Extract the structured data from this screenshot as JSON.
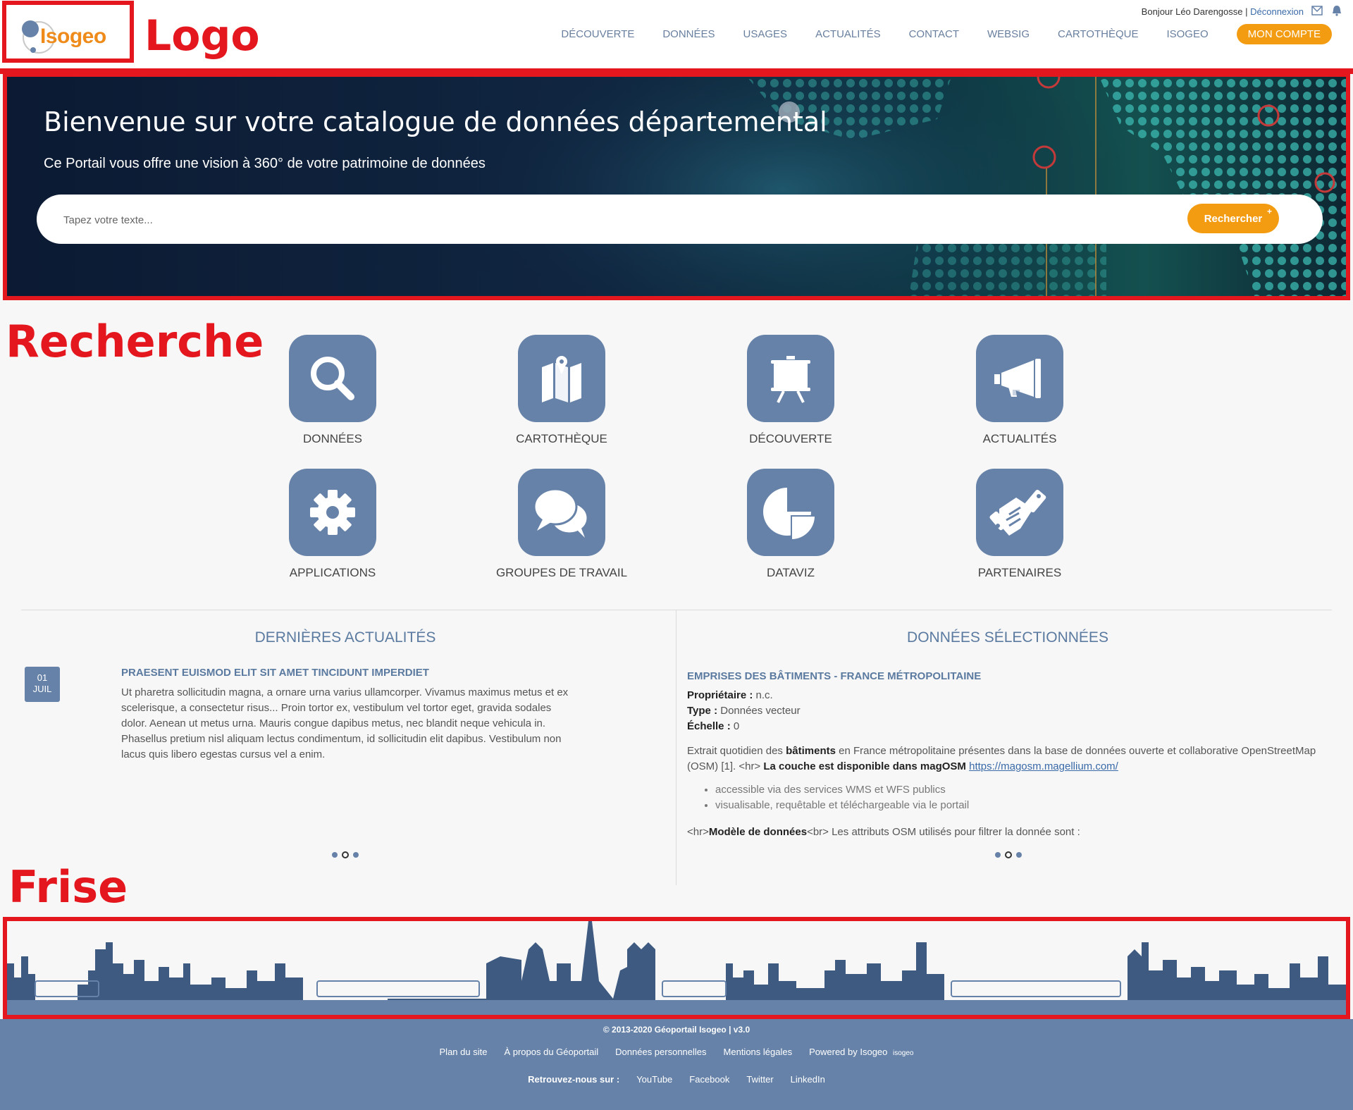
{
  "annotations": {
    "logo": "Logo",
    "search": "Recherche",
    "frieze": "Frise"
  },
  "logo": {
    "text": "Isogeo"
  },
  "header": {
    "greeting": "Bonjour Léo Darengosse |",
    "logout": "Déconnexion",
    "nav": [
      "DÉCOUVERTE",
      "DONNÉES",
      "USAGES",
      "ACTUALITÉS",
      "CONTACT",
      "WEBSIG",
      "CARTOTHÈQUE",
      "ISOGEO"
    ],
    "account_button": "MON COMPTE"
  },
  "hero": {
    "title": "Bienvenue sur votre catalogue de données départemental",
    "subtitle": "Ce Portail vous offre une vision à 360° de votre patrimoine de données",
    "search_placeholder": "Tapez votre texte...",
    "search_button": "Rechercher",
    "search_plus": "+"
  },
  "tiles": [
    {
      "label": "DONNÉES",
      "icon": "search-icon"
    },
    {
      "label": "CARTOTHÈQUE",
      "icon": "map-icon"
    },
    {
      "label": "DÉCOUVERTE",
      "icon": "easel-icon"
    },
    {
      "label": "ACTUALITÉS",
      "icon": "megaphone-icon"
    },
    {
      "label": "APPLICATIONS",
      "icon": "gear-icon"
    },
    {
      "label": "GROUPES DE TRAVAIL",
      "icon": "chat-bubbles-icon"
    },
    {
      "label": "DATAVIZ",
      "icon": "pie-chart-icon"
    },
    {
      "label": "PARTENAIRES",
      "icon": "handshake-icon"
    }
  ],
  "news": {
    "title": "DERNIÈRES ACTUALITÉS",
    "date_day": "01",
    "date_month": "JUIL",
    "headline": "PRAESENT EUISMOD ELIT SIT AMET TINCIDUNT IMPERDIET",
    "body": "Ut pharetra sollicitudin magna, a ornare urna varius ullamcorper. Vivamus maximus metus et ex scelerisque, a consectetur risus... Proin tortor ex, vestibulum vel tortor eget, gravida sodales dolor. Aenean ut metus urna. Mauris congue dapibus metus, nec blandit neque vehicula in. Phasellus pretium nisl aliquam lectus condimentum, id sollicitudin elit dapibus. Vestibulum non lacus quis libero egestas cursus vel a enim."
  },
  "selected_data": {
    "title": "DONNÉES SÉLECTIONNÉES",
    "headline": "EMPRISES DES BÂTIMENTS - FRANCE MÉTROPOLITAINE",
    "owner_label": "Propriétaire :",
    "owner_value": "n.c.",
    "type_label": "Type :",
    "type_value": "Données vecteur",
    "scale_label": "Échelle :",
    "scale_value": "0",
    "desc_1": "Extrait quotidien des",
    "desc_bold_1": "bâtiments",
    "desc_2": "en France métropolitaine présentes dans la base de données ouverte et collaborative OpenStreetMap (OSM) [1]. <hr>",
    "desc_bold_2": "La couche est disponible dans magOSM",
    "desc_link": "https://magosm.magellium.com/",
    "bullets": [
      "accessible via des services WMS et WFS publics",
      "visualisable, requêtable et téléchargeable via le portail"
    ],
    "model_1": "<hr>",
    "model_bold": "Modèle de données",
    "model_2": "<br> Les attributs OSM utilisés pour filtrer la donnée sont :"
  },
  "footer": {
    "copyright": "© 2013-2020 Géoportail Isogeo | v3.0",
    "links": [
      "Plan du site",
      "À propos du Géoportail",
      "Données personnelles",
      "Mentions légales",
      "Powered by Isogeo"
    ],
    "powered_logo": "isogeo",
    "social_label": "Retrouvez-nous sur :",
    "social": [
      "YouTube",
      "Facebook",
      "Twitter",
      "LinkedIn"
    ]
  },
  "colors": {
    "accent": "#f39c12",
    "primary": "#6682a8",
    "annotation": "#e4161e"
  }
}
